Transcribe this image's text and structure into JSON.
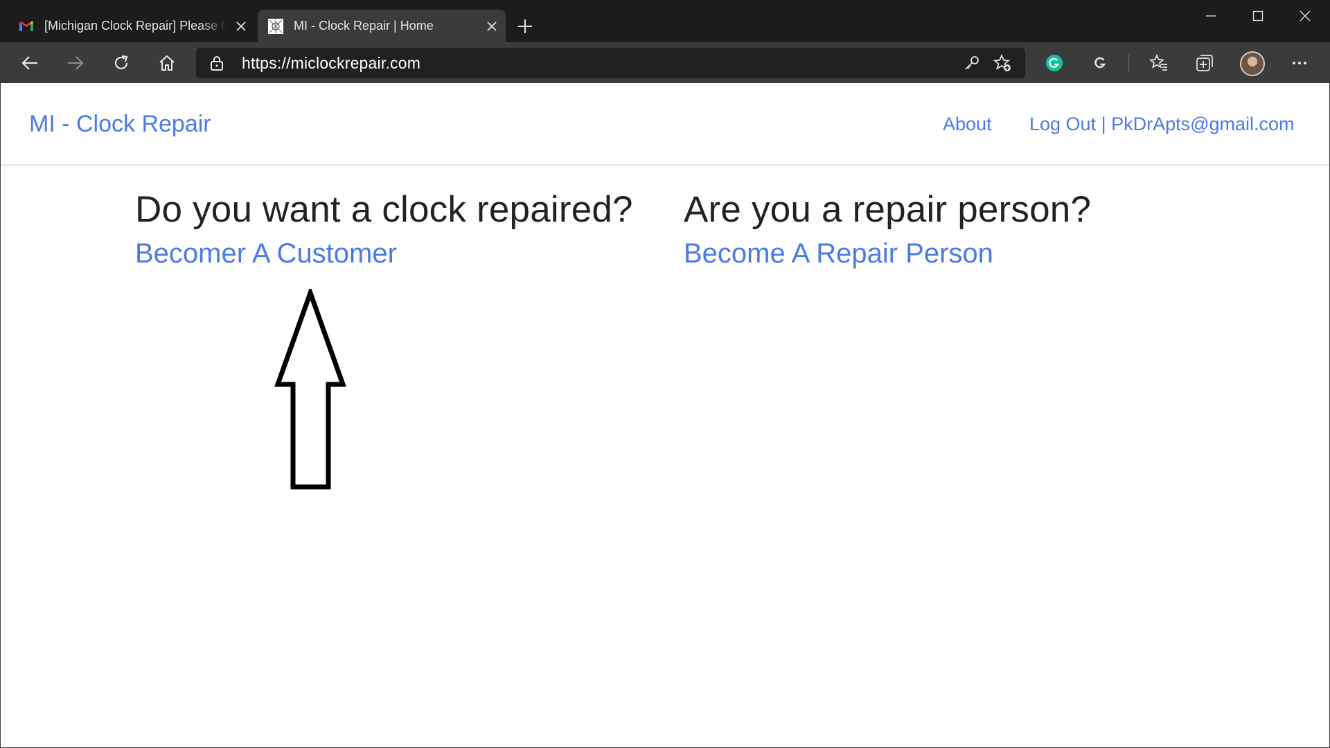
{
  "browser": {
    "tabs": [
      {
        "title": "[Michigan Clock Repair] Please Confirm",
        "active": false,
        "favicon": "gmail-icon"
      },
      {
        "title": "MI - Clock Repair | Home",
        "active": true,
        "favicon": "site-favicon"
      }
    ],
    "address_bar": {
      "url": "https://miclockrepair.com"
    },
    "colors": {
      "chrome_dark": "#1c1c1c",
      "toolbar": "#3b3b3b",
      "grammarly_green": "#15c39a"
    }
  },
  "site": {
    "brand": "MI - Clock Repair",
    "nav": {
      "about": "About",
      "account": "Log Out | PkDrApts@gmail.com"
    },
    "colors": {
      "link": "#4a79e8",
      "heading": "#222222"
    }
  },
  "main": {
    "customer": {
      "heading": "Do you want a clock repaired?",
      "link": "Becomer A Customer"
    },
    "repair_person": {
      "heading": "Are you a repair person?",
      "link": "Become A Repair Person"
    }
  }
}
